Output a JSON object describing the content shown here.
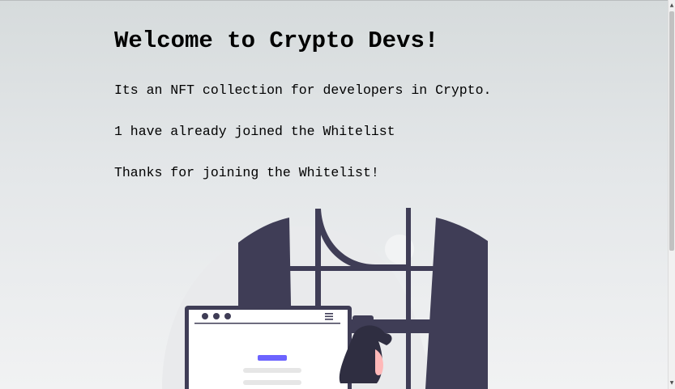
{
  "main": {
    "title": "Welcome to Crypto Devs!",
    "description": "Its an NFT collection for developers in Crypto.",
    "joined_text": "1 have already joined the Whitelist",
    "status_text": "Thanks for joining the Whitelist!"
  },
  "illustration": {
    "name": "crypto-devs-illustration",
    "colors": {
      "dark": "#3f3d56",
      "accent": "#6c63ff",
      "blob": "#e9e9eb",
      "skin": "#ffb8b8",
      "line": "#e6e6e6"
    }
  },
  "scrollbar": {
    "up_icon": "triangle-up-icon",
    "down_icon": "triangle-down-icon"
  }
}
